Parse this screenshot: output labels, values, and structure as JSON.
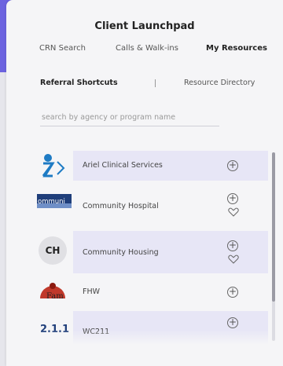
{
  "header": {
    "title": "Client Launchpad"
  },
  "top_tabs": [
    "CRN Search",
    "Calls & Walk-ins",
    "My Resources"
  ],
  "sub_tabs": [
    "Referral Shortcuts",
    "Resource Directory"
  ],
  "search": {
    "placeholder": "search by agency or program name",
    "value": ""
  },
  "resources": [
    {
      "name": "Ariel Clinical Services",
      "logo_text": "",
      "icon": "ariel-clinical-logo"
    },
    {
      "name": "Community Hospital",
      "logo_text": "ommuni",
      "icon": "community-hospital-logo"
    },
    {
      "name": "Community Housing",
      "logo_text": "CH",
      "icon": "ch-avatar"
    },
    {
      "name": "FHW",
      "logo_text": "Fam",
      "icon": "fhw-logo"
    },
    {
      "name": "WC211",
      "logo_text": "2.1.1",
      "icon": "wc211-logo"
    }
  ],
  "colors": {
    "accent": "#6c63e0",
    "row_highlight": "#e7e6f6",
    "panel": "#f5f5f7"
  }
}
